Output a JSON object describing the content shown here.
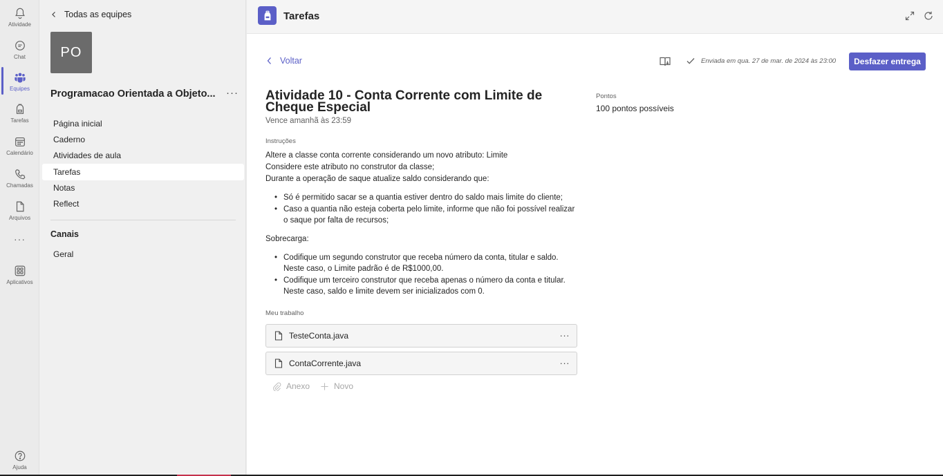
{
  "rail": {
    "items": [
      {
        "label": "Atividade",
        "icon": "bell-icon"
      },
      {
        "label": "Chat",
        "icon": "chat-icon"
      },
      {
        "label": "Equipes",
        "icon": "teams-icon"
      },
      {
        "label": "Tarefas",
        "icon": "backpack-icon"
      },
      {
        "label": "Calendário",
        "icon": "calendar-icon"
      },
      {
        "label": "Chamadas",
        "icon": "phone-icon"
      },
      {
        "label": "Arquivos",
        "icon": "file-icon"
      },
      {
        "label": "Aplicativos",
        "icon": "apps-icon"
      },
      {
        "label": "Ajuda",
        "icon": "help-icon"
      }
    ],
    "more_glyph": "···",
    "active": "Equipes"
  },
  "sidebar": {
    "back_label": "Todas as equipes",
    "team_initials": "PO",
    "team_name": "Programacao Orientada a Objeto...",
    "more_glyph": "···",
    "nav": [
      "Página inicial",
      "Caderno",
      "Atividades de aula",
      "Tarefas",
      "Notas",
      "Reflect"
    ],
    "active_nav": "Tarefas",
    "channels_heading": "Canais",
    "channels": [
      "Geral"
    ]
  },
  "topbar": {
    "title": "Tarefas"
  },
  "assignment": {
    "back_label": "Voltar",
    "sent_status": "Enviada em qua. 27 de mar. de 2024 às 23:00",
    "undo_button": "Desfazer entrega",
    "title": "Atividade 10 - Conta Corrente com Limite de Cheque Especial",
    "due": "Vence amanhã às 23:59",
    "points_heading": "Pontos",
    "points_value": "100 pontos possíveis",
    "instructions_heading": "Instruções",
    "instructions": {
      "lines": [
        "Altere a classe conta corrente considerando um novo atributo: Limite",
        "Considere este atributo no construtor da classe;",
        "Durante a operação de saque atualize saldo considerando que:"
      ],
      "bullets1": [
        "Só é permitido sacar se a quantia estiver dentro do saldo mais limite do cliente;",
        "Caso a quantia não esteja coberta pelo limite, informe que não foi possível realizar o saque por falta de recursos;"
      ],
      "overload_label": "Sobrecarga:",
      "bullets2": [
        "Codifique um segundo construtor que receba número da conta, titular e saldo. Neste caso, o Limite padrão é de R$1000,00.",
        "Codifique um terceiro construtor que receba apenas o número da conta e titular. Neste caso, saldo e limite devem ser inicializados com 0."
      ]
    },
    "my_work_heading": "Meu trabalho",
    "files": [
      "TesteConta.java",
      "ContaCorrente.java"
    ],
    "file_more_glyph": "···",
    "attach_label": "Anexo",
    "new_label": "Novo"
  }
}
